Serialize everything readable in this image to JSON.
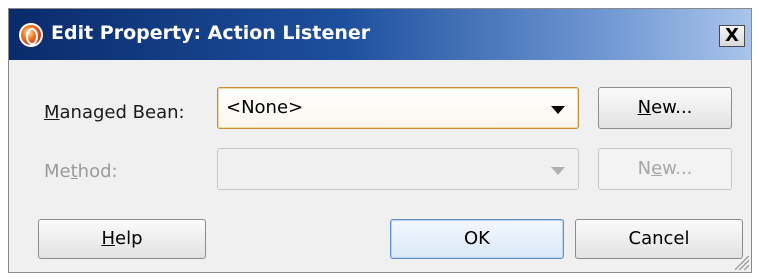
{
  "dialog": {
    "title": "Edit Property: Action Listener",
    "close_label": "X"
  },
  "fields": {
    "managed_bean": {
      "label_pre": "",
      "label_mnemonic": "M",
      "label_post": "anaged Bean:",
      "value": "<None>",
      "new_button": {
        "mnemonic": "N",
        "rest": "ew..."
      }
    },
    "method": {
      "label_pre": "Me",
      "label_mnemonic": "t",
      "label_post": "hod:",
      "value": "",
      "new_button": {
        "pre": "N",
        "mnemonic": "e",
        "post": "w..."
      }
    }
  },
  "buttons": {
    "help": {
      "mnemonic": "H",
      "rest": "elp"
    },
    "ok": "OK",
    "cancel": "Cancel"
  }
}
